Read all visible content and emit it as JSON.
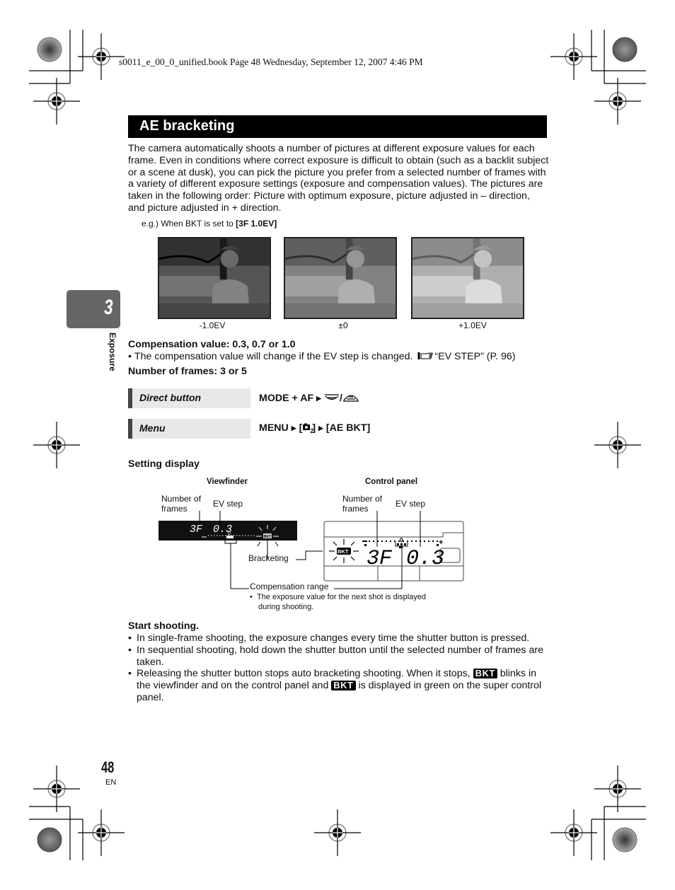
{
  "header": {
    "print_info": "s0011_e_00_0_unified.book  Page 48  Wednesday, September 12, 2007  4:46 PM"
  },
  "title": "AE bracketing",
  "intro": "The camera automatically shoots a number of pictures at different exposure values for each frame. Even in conditions where correct exposure is difficult to obtain (such as a backlit subject or a scene at dusk), you can pick the picture you prefer from a selected number of frames with a variety of different exposure settings (exposure and compensation values). The pictures are taken in the following order: Picture with optimum exposure, picture adjusted in – direction, and picture adjusted in + direction.",
  "example": {
    "prefix": "e.g.) When BKT is set to ",
    "value": "[3F 1.0EV]"
  },
  "photos": [
    {
      "caption": "-1.0EV",
      "exposure": -1.0
    },
    {
      "caption": "±0",
      "exposure": 0
    },
    {
      "caption": "+1.0EV",
      "exposure": 1.0
    }
  ],
  "chapter": {
    "number": "3",
    "label": "Exposure"
  },
  "compensation": {
    "heading": "Compensation value: 0.3, 0.7 or 1.0",
    "note": "The compensation value will change if the EV step is changed.",
    "ref": "“EV STEP” (P. 96)",
    "ref_icon": "reference-hand-icon"
  },
  "frames": {
    "heading": "Number of frames: 3 or 5"
  },
  "options": [
    {
      "label": "Direct button",
      "path_text": "MODE + AF",
      "path_after": "",
      "icons": [
        "sequential-icon",
        "self-timer-icon"
      ]
    },
    {
      "label": "Menu",
      "path_text": "MENU",
      "path_mid": "[",
      "path_tab": "2",
      "path_end": "]",
      "path_final": "[AE BKT]"
    }
  ],
  "setting_display": {
    "heading": "Setting display",
    "viewfinder": {
      "title": "Viewfinder",
      "label_frames": [
        "Number of",
        "frames"
      ],
      "label_ev": "EV step",
      "frames_value": "3F",
      "ev_value": "0.3",
      "label_bracketing": "Bracketing",
      "bkt": "BKT"
    },
    "control_panel": {
      "title": "Control panel",
      "label_frames": [
        "Number of",
        "frames"
      ],
      "label_ev": "EV step",
      "frames_value": "3F",
      "ev_value": "0.3",
      "bkt": "BKT",
      "scale_minus": "−",
      "scale_zero": "0",
      "scale_plus": "+"
    },
    "compensation_range": "Compensation range",
    "compensation_note": [
      "The exposure value for the next shot is displayed",
      "during shooting."
    ]
  },
  "start": {
    "heading": "Start shooting.",
    "bullets": [
      "In single-frame shooting, the exposure changes every time the shutter button is pressed.",
      "In sequential shooting, hold down the shutter button until the selected number of frames are taken."
    ],
    "bullet3": {
      "a": "Releasing the shutter button stops auto bracketing shooting. When it stops, ",
      "badge": "BKT",
      "b": " blinks in the viewfinder and on the control panel and ",
      "c": " is displayed in green on the super control panel."
    }
  },
  "footer": {
    "page_number": "48",
    "lang": "EN"
  }
}
